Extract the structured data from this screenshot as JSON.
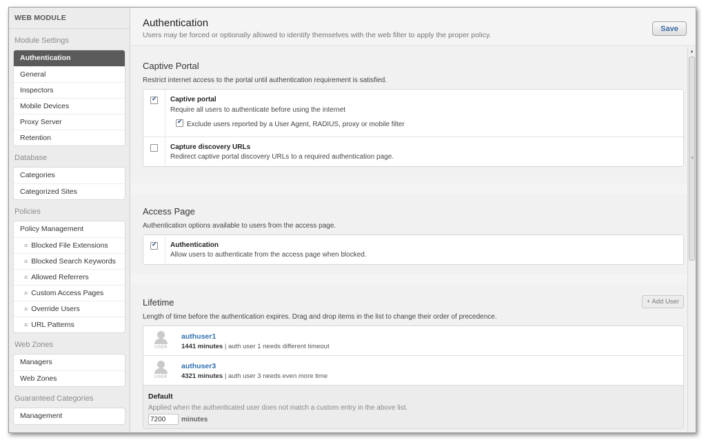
{
  "sidebar": {
    "title": "WEB MODULE",
    "sections": [
      {
        "label": "Module Settings",
        "items": [
          "Authentication",
          "General",
          "Inspectors",
          "Mobile Devices",
          "Proxy Server",
          "Retention"
        ]
      },
      {
        "label": "Database",
        "items": [
          "Categories",
          "Categorized Sites"
        ]
      },
      {
        "label": "Policies",
        "items": [
          "Policy Management",
          "Blocked File Extensions",
          "Blocked Search Keywords",
          "Allowed Referrers",
          "Custom Access Pages",
          "Override Users",
          "URL Patterns"
        ]
      },
      {
        "label": "Web Zones",
        "items": [
          "Managers",
          "Web Zones"
        ]
      },
      {
        "label": "Guaranteed Categories",
        "items": [
          "Management"
        ]
      }
    ],
    "active_item": "Authentication"
  },
  "header": {
    "title": "Authentication",
    "subtitle": "Users may be forced or optionally allowed to identify themselves with the web filter to apply the proper policy.",
    "save_label": "Save"
  },
  "captive": {
    "title": "Captive Portal",
    "desc": "Restrict internet access to the portal until authentication requirement is satisfied.",
    "portal_title": "Captive portal",
    "portal_checked": true,
    "portal_desc": "Require all users to authenticate before using the internet",
    "exclude_label": "Exclude users reported by a User Agent, RADIUS, proxy or mobile filter",
    "exclude_checked": true,
    "discovery_title": "Capture discovery URLs",
    "discovery_checked": false,
    "discovery_desc": "Redirect captive portal discovery URLs to a required authentication page."
  },
  "access": {
    "title": "Access Page",
    "desc": "Authentication options available to users from the access page.",
    "auth_title": "Authentication",
    "auth_checked": true,
    "auth_desc": "Allow users to authenticate from the access page when blocked."
  },
  "lifetime": {
    "title": "Lifetime",
    "desc": "Length of time before the authentication expires. Drag and drop items in the list to change their order of precedence.",
    "add_user_label": "+ Add User",
    "avatar_label": "USER",
    "users": [
      {
        "name": "authuser1",
        "minutes": "1441 minutes",
        "note": "| auth user 1 needs different timeout"
      },
      {
        "name": "authuser3",
        "minutes": "4321 minutes",
        "note": "| auth user 3 needs even more time"
      }
    ],
    "default_title": "Default",
    "default_desc": "Applied when the authenticated user does not match a custom entry in the above list.",
    "default_value": "7200",
    "minutes_label": "minutes"
  },
  "icons": {
    "scroll_up": "triangle-up-icon",
    "scroll_grip": "grip-icon",
    "list_bullet": "list-icon",
    "user_avatar": "user-avatar-icon"
  }
}
